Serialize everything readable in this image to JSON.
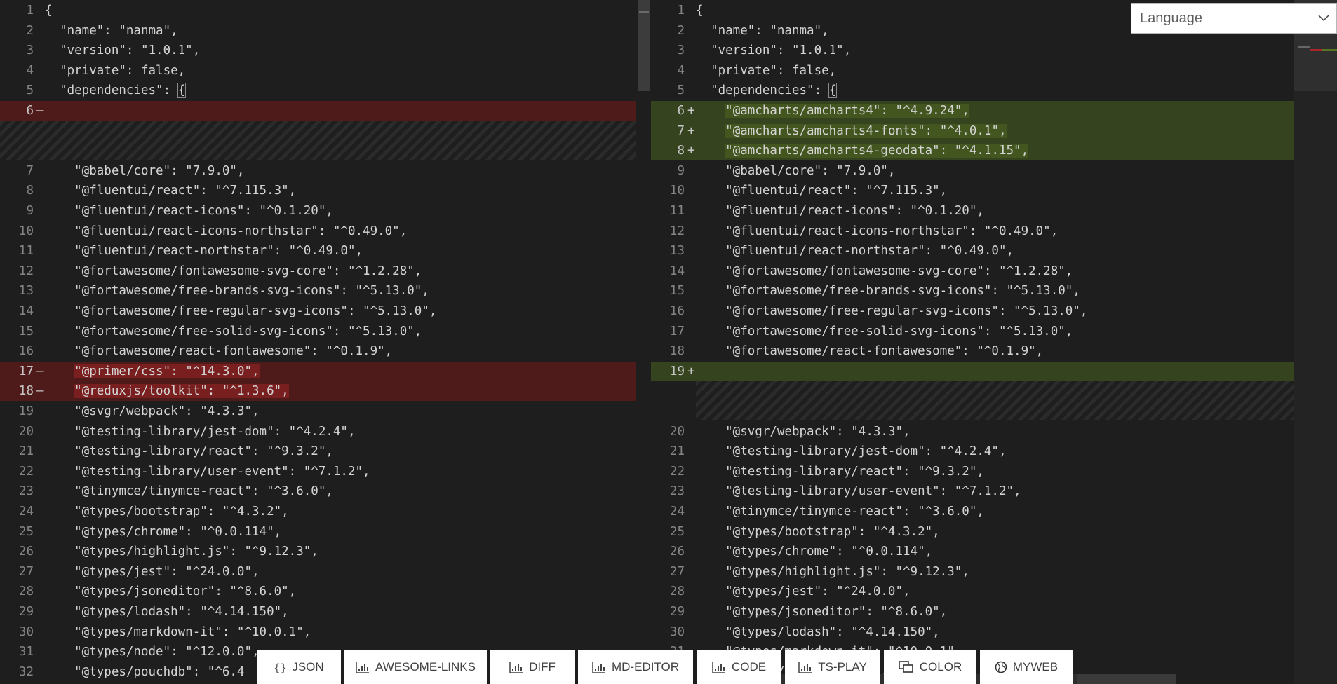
{
  "language_select": {
    "label": "Language"
  },
  "toolbar": [
    {
      "label": "JSON",
      "icon": "braces-icon"
    },
    {
      "label": "AWESOME-LINKS",
      "icon": "chart-icon"
    },
    {
      "label": "DIFF",
      "icon": "chart-icon"
    },
    {
      "label": "MD-EDITOR",
      "icon": "chart-icon"
    },
    {
      "label": "CODE",
      "icon": "chart-icon"
    },
    {
      "label": "TS-PLAY",
      "icon": "chart-icon"
    },
    {
      "label": "COLOR",
      "icon": "windows-icon"
    },
    {
      "label": "MYWEB",
      "icon": "globe-icon"
    }
  ],
  "colors": {
    "added_bg": "#36431f",
    "removed_bg": "#4e1a1a",
    "editor_bg": "#1e1e1e"
  },
  "left": [
    {
      "type": "line",
      "num": "1",
      "text": "{"
    },
    {
      "type": "line",
      "num": "2",
      "text": "  \"name\": \"nanma\","
    },
    {
      "type": "line",
      "num": "3",
      "text": "  \"version\": \"1.0.1\","
    },
    {
      "type": "line",
      "num": "4",
      "text": "  \"private\": false,"
    },
    {
      "type": "line",
      "num": "5",
      "text": "  \"dependencies\": {"
    },
    {
      "type": "removed",
      "num": "6",
      "text": ""
    },
    {
      "type": "filler",
      "full": true
    },
    {
      "type": "line",
      "num": "7",
      "text": "    \"@babel/core\": \"7.9.0\","
    },
    {
      "type": "line",
      "num": "8",
      "text": "    \"@fluentui/react\": \"^7.115.3\","
    },
    {
      "type": "line",
      "num": "9",
      "text": "    \"@fluentui/react-icons\": \"^0.1.20\","
    },
    {
      "type": "line",
      "num": "10",
      "text": "    \"@fluentui/react-icons-northstar\": \"^0.49.0\","
    },
    {
      "type": "line",
      "num": "11",
      "text": "    \"@fluentui/react-northstar\": \"^0.49.0\","
    },
    {
      "type": "line",
      "num": "12",
      "text": "    \"@fortawesome/fontawesome-svg-core\": \"^1.2.28\","
    },
    {
      "type": "line",
      "num": "13",
      "text": "    \"@fortawesome/free-brands-svg-icons\": \"^5.13.0\","
    },
    {
      "type": "line",
      "num": "14",
      "text": "    \"@fortawesome/free-regular-svg-icons\": \"^5.13.0\","
    },
    {
      "type": "line",
      "num": "15",
      "text": "    \"@fortawesome/free-solid-svg-icons\": \"^5.13.0\","
    },
    {
      "type": "line",
      "num": "16",
      "text": "    \"@fortawesome/react-fontawesome\": \"^0.1.9\","
    },
    {
      "type": "removed",
      "num": "17",
      "text": "    \"@primer/css\": \"^14.3.0\","
    },
    {
      "type": "removed",
      "num": "18",
      "text": "    \"@reduxjs/toolkit\": \"^1.3.6\","
    },
    {
      "type": "line",
      "num": "19",
      "text": "    \"@svgr/webpack\": \"4.3.3\","
    },
    {
      "type": "line",
      "num": "20",
      "text": "    \"@testing-library/jest-dom\": \"^4.2.4\","
    },
    {
      "type": "line",
      "num": "21",
      "text": "    \"@testing-library/react\": \"^9.3.2\","
    },
    {
      "type": "line",
      "num": "22",
      "text": "    \"@testing-library/user-event\": \"^7.1.2\","
    },
    {
      "type": "line",
      "num": "23",
      "text": "    \"@tinymce/tinymce-react\": \"^3.6.0\","
    },
    {
      "type": "line",
      "num": "24",
      "text": "    \"@types/bootstrap\": \"^4.3.2\","
    },
    {
      "type": "line",
      "num": "25",
      "text": "    \"@types/chrome\": \"^0.0.114\","
    },
    {
      "type": "line",
      "num": "26",
      "text": "    \"@types/highlight.js\": \"^9.12.3\","
    },
    {
      "type": "line",
      "num": "27",
      "text": "    \"@types/jest\": \"^24.0.0\","
    },
    {
      "type": "line",
      "num": "28",
      "text": "    \"@types/jsoneditor\": \"^8.6.0\","
    },
    {
      "type": "line",
      "num": "29",
      "text": "    \"@types/lodash\": \"^4.14.150\","
    },
    {
      "type": "line",
      "num": "30",
      "text": "    \"@types/markdown-it\": \"^10.0.1\","
    },
    {
      "type": "line",
      "num": "31",
      "text": "    \"@types/node\": \"^12.0.0\","
    },
    {
      "type": "line",
      "num": "32",
      "text": "    \"@types/pouchdb\": \"^6.4"
    }
  ],
  "right": [
    {
      "type": "line",
      "num": "1",
      "text": "{"
    },
    {
      "type": "line",
      "num": "2",
      "text": "  \"name\": \"nanma\","
    },
    {
      "type": "line",
      "num": "3",
      "text": "  \"version\": \"1.0.1\","
    },
    {
      "type": "line",
      "num": "4",
      "text": "  \"private\": false,"
    },
    {
      "type": "line",
      "num": "5",
      "text": "  \"dependencies\": {"
    },
    {
      "type": "added",
      "num": "6",
      "text": "    \"@amcharts/amcharts4\": \"^4.9.24\","
    },
    {
      "type": "added",
      "num": "7",
      "text": "    \"@amcharts/amcharts4-fonts\": \"^4.0.1\","
    },
    {
      "type": "added",
      "num": "8",
      "text": "    \"@amcharts/amcharts4-geodata\": \"^4.1.15\","
    },
    {
      "type": "line",
      "num": "9",
      "text": "    \"@babel/core\": \"7.9.0\","
    },
    {
      "type": "line",
      "num": "10",
      "text": "    \"@fluentui/react\": \"^7.115.3\","
    },
    {
      "type": "line",
      "num": "11",
      "text": "    \"@fluentui/react-icons\": \"^0.1.20\","
    },
    {
      "type": "line",
      "num": "12",
      "text": "    \"@fluentui/react-icons-northstar\": \"^0.49.0\","
    },
    {
      "type": "line",
      "num": "13",
      "text": "    \"@fluentui/react-northstar\": \"^0.49.0\","
    },
    {
      "type": "line",
      "num": "14",
      "text": "    \"@fortawesome/fontawesome-svg-core\": \"^1.2.28\","
    },
    {
      "type": "line",
      "num": "15",
      "text": "    \"@fortawesome/free-brands-svg-icons\": \"^5.13.0\","
    },
    {
      "type": "line",
      "num": "16",
      "text": "    \"@fortawesome/free-regular-svg-icons\": \"^5.13.0\","
    },
    {
      "type": "line",
      "num": "17",
      "text": "    \"@fortawesome/free-solid-svg-icons\": \"^5.13.0\","
    },
    {
      "type": "line",
      "num": "18",
      "text": "    \"@fortawesome/react-fontawesome\": \"^0.1.9\","
    },
    {
      "type": "added",
      "num": "19",
      "text": ""
    },
    {
      "type": "filler",
      "full": false
    },
    {
      "type": "line",
      "num": "20",
      "text": "    \"@svgr/webpack\": \"4.3.3\","
    },
    {
      "type": "line",
      "num": "21",
      "text": "    \"@testing-library/jest-dom\": \"^4.2.4\","
    },
    {
      "type": "line",
      "num": "22",
      "text": "    \"@testing-library/react\": \"^9.3.2\","
    },
    {
      "type": "line",
      "num": "23",
      "text": "    \"@testing-library/user-event\": \"^7.1.2\","
    },
    {
      "type": "line",
      "num": "24",
      "text": "    \"@tinymce/tinymce-react\": \"^3.6.0\","
    },
    {
      "type": "line",
      "num": "25",
      "text": "    \"@types/bootstrap\": \"^4.3.2\","
    },
    {
      "type": "line",
      "num": "26",
      "text": "    \"@types/chrome\": \"^0.0.114\","
    },
    {
      "type": "line",
      "num": "27",
      "text": "    \"@types/highlight.js\": \"^9.12.3\","
    },
    {
      "type": "line",
      "num": "28",
      "text": "    \"@types/jest\": \"^24.0.0\","
    },
    {
      "type": "line",
      "num": "29",
      "text": "    \"@types/jsoneditor\": \"^8.6.0\","
    },
    {
      "type": "line",
      "num": "30",
      "text": "    \"@types/lodash\": \"^4.14.150\","
    },
    {
      "type": "line",
      "num": "31",
      "text": "    \"@types/markdown-it\": \"^10.0.1\","
    },
    {
      "type": "line",
      "num": "32",
      "text": "    \"@types/node\": \"^12.0.0\","
    }
  ]
}
